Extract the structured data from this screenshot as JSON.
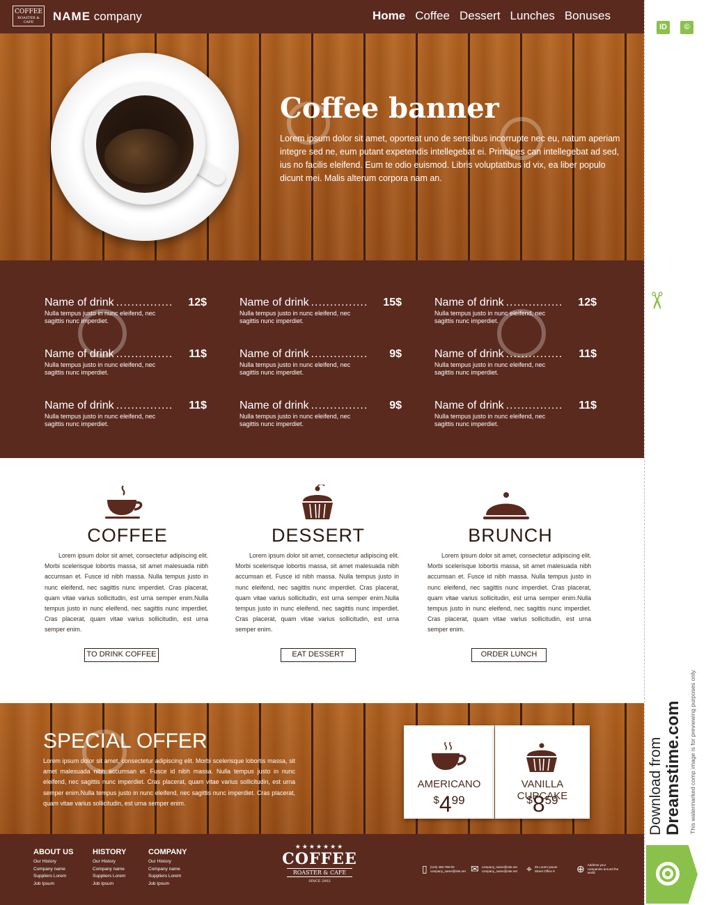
{
  "header": {
    "logo_text": "COFFEE",
    "logo_sub": "ROASTER & CAFE",
    "brand_name": "NAME",
    "brand_suffix": "company",
    "nav": [
      "Home",
      "Coffee",
      "Dessert",
      "Lunches",
      "Bonuses"
    ]
  },
  "banner": {
    "title": "Coffee banner",
    "text": "Lorem ipsum dolor sit amet, oporteat uno de sensibus incorrupte nec eu, natum aperiam integre sed ne, eum putant expetendis intellegebat ei. Principes can intellegebat ad sed, ius no facilis eleifend. Eum te odio euismod. Libris voluptatibus id vix, ea liber populo dicunt mei. Malis alterum corpora nam an."
  },
  "menu": {
    "items": [
      {
        "name": "Name of drink",
        "dots": "...............",
        "price": "12$",
        "desc": "Nulla tempus justo in nunc eleifend, nec sagittis nunc imperdiet."
      },
      {
        "name": "Name of drink",
        "dots": "...............",
        "price": "15$",
        "desc": "Nulla tempus justo in nunc eleifend, nec sagittis nunc imperdiet."
      },
      {
        "name": "Name of drink",
        "dots": "...............",
        "price": "12$",
        "desc": "Nulla tempus justo in nunc eleifend, nec sagittis nunc imperdiet."
      },
      {
        "name": "Name of drink",
        "dots": "...............",
        "price": "11$",
        "desc": "Nulla tempus justo in nunc eleifend, nec sagittis nunc imperdiet."
      },
      {
        "name": "Name of drink",
        "dots": "...............",
        "price": "9$",
        "desc": "Nulla tempus justo in nunc eleifend, nec sagittis nunc imperdiet."
      },
      {
        "name": "Name of drink",
        "dots": "...............",
        "price": "11$",
        "desc": "Nulla tempus justo in nunc eleifend, nec sagittis nunc imperdiet."
      },
      {
        "name": "Name of drink",
        "dots": "...............",
        "price": "11$",
        "desc": "Nulla tempus justo in nunc eleifend, nec sagittis nunc imperdiet."
      },
      {
        "name": "Name of drink",
        "dots": "...............",
        "price": "9$",
        "desc": "Nulla tempus justo in nunc eleifend, nec sagittis nunc imperdiet."
      },
      {
        "name": "Name of drink",
        "dots": "...............",
        "price": "11$",
        "desc": "Nulla tempus justo in nunc eleifend, nec sagittis nunc imperdiet."
      }
    ]
  },
  "features": {
    "text": "Lorem ipsum dolor sit amet, consectetur adipiscing elit. Morbi scelerisque lobortis massa, sit amet malesuada nibh accumsan et. Fusce id nibh massa. Nulla tempus justo in nunc eleifend, nec sagittis nunc imperdiet. Cras placerat, quam vitae varius sollicitudin, est urna semper enim.Nulla tempus justo in nunc eleifend, nec sagittis nunc imperdiet. Cras placerat, quam vitae varius sollicitudin, est urna semper enim.",
    "coffee": {
      "title": "COFFEE",
      "button": "TO DRINK COFFEE"
    },
    "dessert": {
      "title": "DESSERT",
      "button": "EAT DESSERT"
    },
    "brunch": {
      "title": "BRUNCH",
      "button": "ORDER LUNCH"
    }
  },
  "offer": {
    "title": "SPECIAL OFFER",
    "text": "Lorem ipsum dolor sit amet, consectetur adipiscing elit. Morbi scelerisque lobortis massa, sit amet malesuada nibh accumsan et. Fusce id nibh massa. Nulla tempus justo in nunc eleifend, nec sagittis nunc imperdiet. Cras placerat, quam vitae varius sollicitudin, est urna semper enim.Nulla tempus justo in nunc eleifend, nec sagittis nunc imperdiet. Cras placerat, quam vitae varius sollicitudin, est urna semper enim.",
    "cards": [
      {
        "name": "AMERICANO",
        "currency": "$",
        "price_main": "4",
        "price_cents": "99"
      },
      {
        "name": "VANILLA CUPCAKE",
        "currency": "$",
        "price_main": "8",
        "price_cents": "59"
      }
    ]
  },
  "footer": {
    "columns": [
      {
        "title": "ABOUT US",
        "links": [
          "Our History",
          "Company name",
          "Suppliers Lorem",
          "Job Ipsum"
        ]
      },
      {
        "title": "HISTORY",
        "links": [
          "Our History",
          "Company name",
          "Suppliers Lorem",
          "Job Ipsum"
        ]
      },
      {
        "title": "COMPANY",
        "links": [
          "Our History",
          "Company name",
          "Suppliers Lorem",
          "Job Ipsum"
        ]
      }
    ],
    "logo": {
      "stars": "★★★★★★★",
      "big": "COFFEE",
      "ribbon": "ROASTER & CAFE",
      "since": "SINCE 2002"
    },
    "contacts": [
      {
        "icon": "phone-icon",
        "glyph": "▯",
        "text": "(123) 456-789-00 company_name@site.net"
      },
      {
        "icon": "mail-icon",
        "glyph": "✉",
        "text": "company_name@site.net company_name@site.net"
      },
      {
        "icon": "location-icon",
        "glyph": "⌖",
        "text": "25 Lorem Ipsum Street Office 9"
      },
      {
        "icon": "globe-icon",
        "glyph": "⊕",
        "text": "Address your companies around the world"
      }
    ]
  },
  "stock": {
    "download_line1": "Download from",
    "download_line2": "Dreamstime.com",
    "notice": "This watermarked comp image is for previewing purposes only.",
    "btn1": "ID",
    "btn2": "©"
  },
  "colors": {
    "brown": "#5a2a1f",
    "wood": "#a85a1e",
    "accent_green": "#8ac14a"
  }
}
